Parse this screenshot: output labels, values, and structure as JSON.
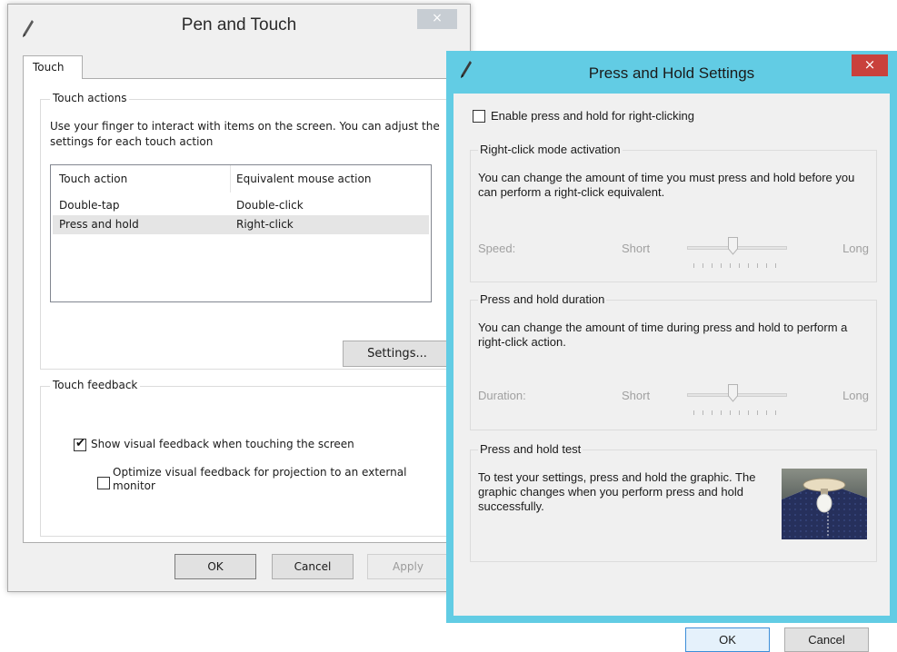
{
  "pen_touch": {
    "title": "Pen and Touch",
    "close_glyph": "×",
    "tab_label": "Touch",
    "touch_actions": {
      "label": "Touch actions",
      "description": "Use your finger to interact with items on the screen. You can adjust the settings for each touch action",
      "columns": [
        "Touch action",
        "Equivalent mouse action"
      ],
      "rows": [
        {
          "action": "Double-tap",
          "mouse": "Double-click",
          "selected": false
        },
        {
          "action": "Press and hold",
          "mouse": "Right-click",
          "selected": true
        }
      ],
      "settings_button": "Settings..."
    },
    "touch_feedback": {
      "label": "Touch feedback",
      "visual_feedback_label": "Show visual feedback when touching the screen",
      "visual_feedback_checked": true,
      "projection_label": "Optimize visual feedback for projection to an external monitor",
      "projection_checked": false
    },
    "buttons": {
      "ok": "OK",
      "cancel": "Cancel",
      "apply": "Apply"
    }
  },
  "press_hold": {
    "title": "Press and Hold Settings",
    "close_glyph": "×",
    "enable_label": "Enable press and hold for right-clicking",
    "enable_checked": false,
    "right_click_group": {
      "label": "Right-click mode activation",
      "description": "You can change the amount of time you must press and hold before you can perform a right-click equivalent.",
      "slider_label": "Speed:",
      "min_label": "Short",
      "max_label": "Long",
      "value": 0.45
    },
    "duration_group": {
      "label": "Press and hold duration",
      "description": "You can change the amount of time during press and hold to perform a right-click action.",
      "slider_label": "Duration:",
      "min_label": "Short",
      "max_label": "Long",
      "value": 0.45
    },
    "test_group": {
      "label": "Press and hold test",
      "description": "To test your settings, press and hold the graphic. The graphic changes when you perform press and hold successfully."
    },
    "buttons": {
      "ok": "OK",
      "cancel": "Cancel"
    }
  },
  "colors": {
    "accent_border": "#62cce4",
    "close_active": "#c9413c",
    "close_inactive": "#c7cdd3",
    "selection": "#e5e5e5"
  }
}
